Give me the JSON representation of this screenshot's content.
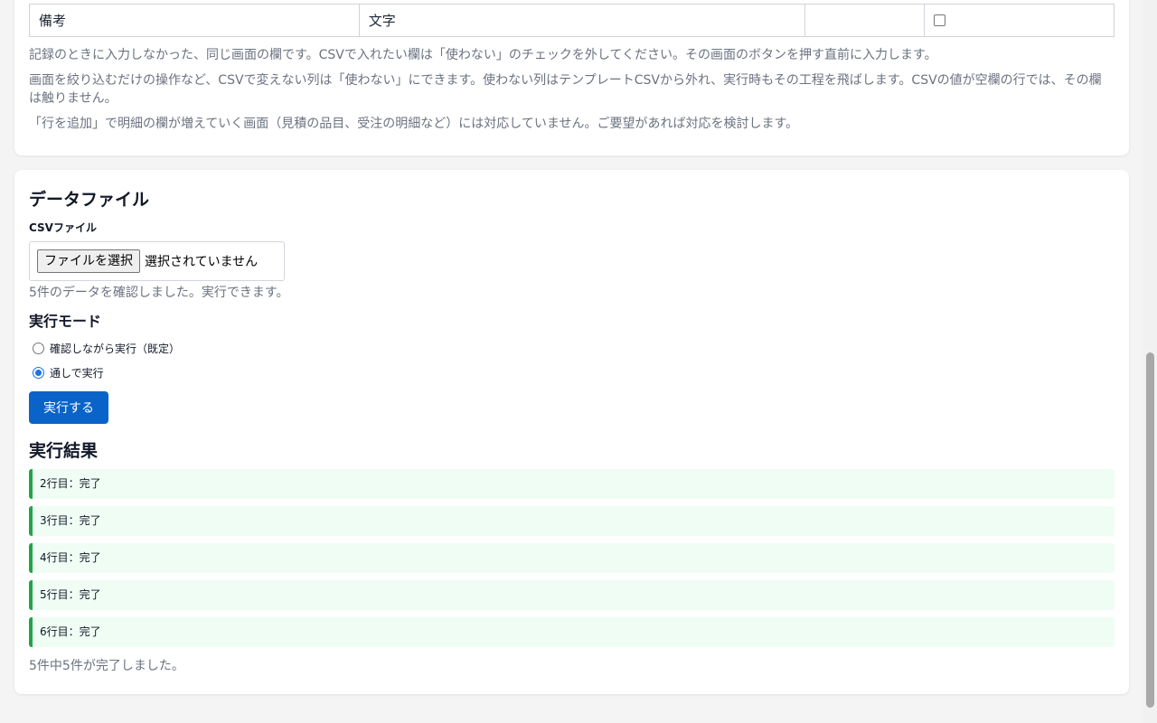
{
  "field_table": {
    "row": {
      "name": "備考",
      "type": "文字",
      "required": "",
      "unused_checked": false
    }
  },
  "notes": [
    "記録のときに入力しなかった、同じ画面の欄です。CSVで入れたい欄は「使わない」のチェックを外してください。その画面のボタンを押す直前に入力します。",
    "画面を絞り込むだけの操作など、CSVで変えない列は「使わない」にできます。使わない列はテンプレートCSVから外れ、実行時もその工程を飛ばします。CSVの値が空欄の行では、その欄は触りません。",
    "「行を追加」で明細の欄が増えていく画面（見積の品目、受注の明細など）には対応していません。ご要望があれば対応を検討します。"
  ],
  "data_file": {
    "title": "データファイル",
    "csv_label": "CSVファイル",
    "choose_button": "ファイルを選択",
    "no_file": "選択されていません",
    "info": "5件のデータを確認しました。実行できます。"
  },
  "mode": {
    "title": "実行モード",
    "options": [
      {
        "label": "確認しながら実行（既定）",
        "checked": false
      },
      {
        "label": "通しで実行",
        "checked": true
      }
    ],
    "run_button": "実行する"
  },
  "results": {
    "title": "実行結果",
    "items": [
      "2行目：完了",
      "3行目：完了",
      "4行目：完了",
      "5行目：完了",
      "6行目：完了"
    ],
    "summary": "5件中5件が完了しました。"
  },
  "colors": {
    "primary": "#0a63c9",
    "success_border": "#22a34a",
    "success_bg": "#f0fdf4"
  }
}
